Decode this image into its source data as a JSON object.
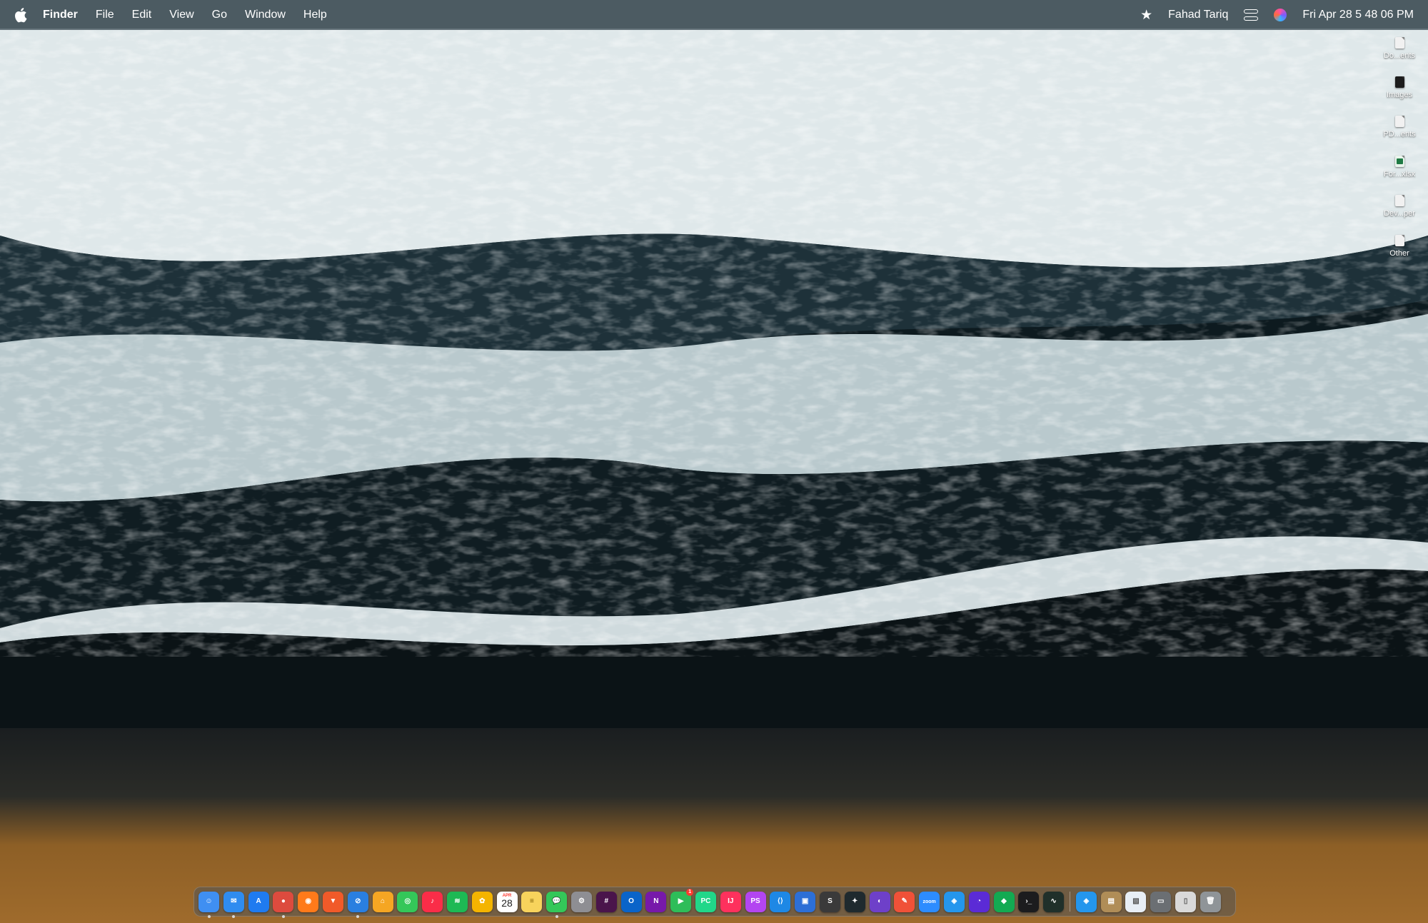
{
  "menubar": {
    "app_name": "Finder",
    "menus": [
      "File",
      "Edit",
      "View",
      "Go",
      "Window",
      "Help"
    ],
    "status": {
      "user": "Fahad Tariq",
      "datetime": "Fri Apr 28  5 48 06 PM"
    }
  },
  "desktop_items": [
    {
      "label": "Do...ents",
      "icon": "document-icon"
    },
    {
      "label": "Images",
      "icon": "image-file-icon"
    },
    {
      "label": "PD...ents",
      "icon": "pdf-document-icon"
    },
    {
      "label": "For...xlsx",
      "icon": "spreadsheet-icon"
    },
    {
      "label": "Dev...per",
      "icon": "document-icon"
    },
    {
      "label": "Other",
      "icon": "document-icon"
    }
  ],
  "dock": {
    "calendar_month": "APR",
    "calendar_day": "28",
    "apps": [
      {
        "id": "finder",
        "color": "#3f8ff2",
        "glyph": "☺",
        "running": true
      },
      {
        "id": "mail",
        "color": "#2f8cf0",
        "glyph": "✉",
        "running": true
      },
      {
        "id": "app-store",
        "color": "#1f7bf0",
        "glyph": "A",
        "running": false
      },
      {
        "id": "chrome",
        "color": "#dd4b3e",
        "glyph": "●",
        "running": true
      },
      {
        "id": "firefox",
        "color": "#ff7a1a",
        "glyph": "◉",
        "running": false
      },
      {
        "id": "brave",
        "color": "#f15a29",
        "glyph": "▼",
        "running": false
      },
      {
        "id": "safari",
        "color": "#2a7fe0",
        "glyph": "⊘",
        "running": true
      },
      {
        "id": "home",
        "color": "#f5a623",
        "glyph": "⌂",
        "running": false
      },
      {
        "id": "find-my",
        "color": "#34c759",
        "glyph": "◎",
        "running": false
      },
      {
        "id": "music",
        "color": "#fa2d48",
        "glyph": "♪",
        "running": false
      },
      {
        "id": "spotify",
        "color": "#1db954",
        "glyph": "≋",
        "running": false
      },
      {
        "id": "photos",
        "color": "#f4b400",
        "glyph": "✿",
        "running": false
      },
      {
        "id": "calendar",
        "color": "#ffffff",
        "glyph": "",
        "running": false
      },
      {
        "id": "notes",
        "color": "#f7d35c",
        "glyph": "≡",
        "running": false
      },
      {
        "id": "messages",
        "color": "#34c759",
        "glyph": "💬",
        "running": true
      },
      {
        "id": "system-settings",
        "color": "#8e8e93",
        "glyph": "⚙",
        "running": false
      },
      {
        "id": "slack",
        "color": "#4a154b",
        "glyph": "#",
        "running": false
      },
      {
        "id": "outlook",
        "color": "#0a64c9",
        "glyph": "O",
        "running": false
      },
      {
        "id": "onenote",
        "color": "#7719aa",
        "glyph": "N",
        "running": false
      },
      {
        "id": "facetime",
        "color": "#2ebd59",
        "glyph": "▶",
        "running": false,
        "badge": "1"
      },
      {
        "id": "pycharm",
        "color": "#21d789",
        "glyph": "PC",
        "running": false
      },
      {
        "id": "intellij",
        "color": "#fe315d",
        "glyph": "IJ",
        "running": false
      },
      {
        "id": "phpstorm",
        "color": "#b345f1",
        "glyph": "PS",
        "running": false
      },
      {
        "id": "vscode",
        "color": "#1e88e5",
        "glyph": "⟨⟩",
        "running": false
      },
      {
        "id": "screen-window",
        "color": "#2d6fd6",
        "glyph": "▣",
        "running": false
      },
      {
        "id": "sublime-text",
        "color": "#3a3a3a",
        "glyph": "S",
        "running": false
      },
      {
        "id": "chatgpt",
        "color": "#1f2a2e",
        "glyph": "✦",
        "running": false
      },
      {
        "id": "github-desktop",
        "color": "#6e40c9",
        "glyph": "◐",
        "running": false
      },
      {
        "id": "swift-playgrounds",
        "color": "#f05138",
        "glyph": "✎",
        "running": false
      },
      {
        "id": "zoom",
        "color": "#2d8cff",
        "glyph": "zoom",
        "running": false
      },
      {
        "id": "docker-desktop",
        "color": "#2496ed",
        "glyph": "◈",
        "running": false
      },
      {
        "id": "proxyman",
        "color": "#5b2bd6",
        "glyph": "◔",
        "running": false
      },
      {
        "id": "mongodb-compass",
        "color": "#13aa52",
        "glyph": "◆",
        "running": false
      },
      {
        "id": "terminal",
        "color": "#1c1c1e",
        "glyph": "›_",
        "running": false
      },
      {
        "id": "activity-monitor",
        "color": "#20302a",
        "glyph": "∿",
        "running": false
      }
    ],
    "others": [
      {
        "id": "docker",
        "color": "#2496ed",
        "glyph": "◈"
      },
      {
        "id": "archive-utility",
        "color": "#b08d57",
        "glyph": "▤"
      },
      {
        "id": "preview",
        "color": "#e8eef5",
        "glyph": "▧"
      },
      {
        "id": "downloads-stack",
        "color": "#6b6f73",
        "glyph": "▭"
      },
      {
        "id": "documents-stack",
        "color": "#d9d9d9",
        "glyph": "▯"
      },
      {
        "id": "trash",
        "color": "#8f9498",
        "glyph": "🗑"
      }
    ]
  }
}
